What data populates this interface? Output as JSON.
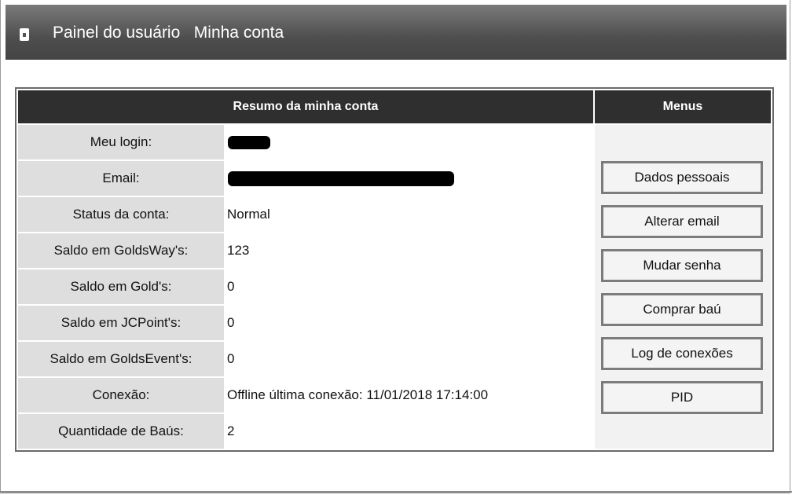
{
  "header": {
    "title": "Painel do usuário   Minha conta"
  },
  "summary": {
    "heading": "Resumo da minha conta",
    "rows": [
      {
        "label": "Meu login:",
        "value": ""
      },
      {
        "label": "Email:",
        "value": ""
      },
      {
        "label": "Status da conta:",
        "value": "Normal"
      },
      {
        "label": "Saldo em GoldsWay's:",
        "value": "123"
      },
      {
        "label": "Saldo em Gold's:",
        "value": "0"
      },
      {
        "label": "Saldo em JCPoint's:",
        "value": "0"
      },
      {
        "label": "Saldo em GoldsEvent's:",
        "value": "0"
      },
      {
        "label": "Conexão:",
        "value": "Offline  última conexão: 11/01/2018 17:14:00"
      },
      {
        "label": "Quantidade de Baús:",
        "value": "2"
      }
    ]
  },
  "menus": {
    "heading": "Menus",
    "items": [
      {
        "label": "Dados pessoais"
      },
      {
        "label": "Alterar email"
      },
      {
        "label": "Mudar senha"
      },
      {
        "label": "Comprar baú"
      },
      {
        "label": "Log de conexões"
      },
      {
        "label": "PID"
      }
    ]
  }
}
